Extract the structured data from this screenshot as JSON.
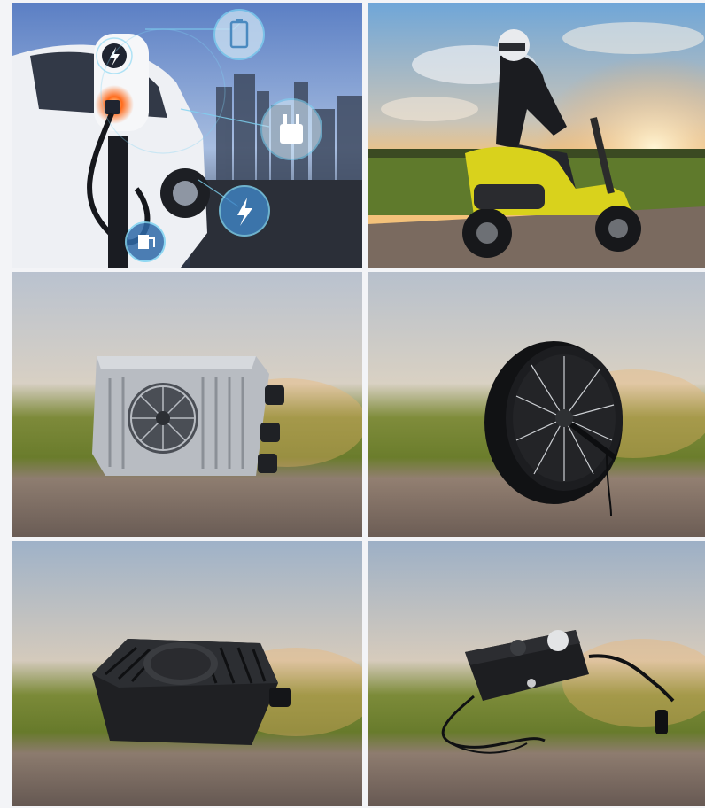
{
  "gallery": {
    "tiles": [
      {
        "subject": "ev-charging-station",
        "icons": [
          "battery-icon",
          "plug-icon",
          "bolt-icon",
          "charger-icon"
        ]
      },
      {
        "subject": "scooter-rider-sunset"
      },
      {
        "subject": "aluminum-battery-charger"
      },
      {
        "subject": "hub-motor-wheel"
      },
      {
        "subject": "black-finned-charger"
      },
      {
        "subject": "compact-charger-with-cables"
      }
    ]
  },
  "colors": {
    "sky_blue": "#6fa6d8",
    "sunset_orange": "#f4a552",
    "field_green": "#5f7a2c",
    "road_gray": "#7a6a5f",
    "scooter_yellow": "#d9d21c",
    "ev_glow": "#ff6a1a",
    "hud_cyan": "#7fd3f2"
  }
}
